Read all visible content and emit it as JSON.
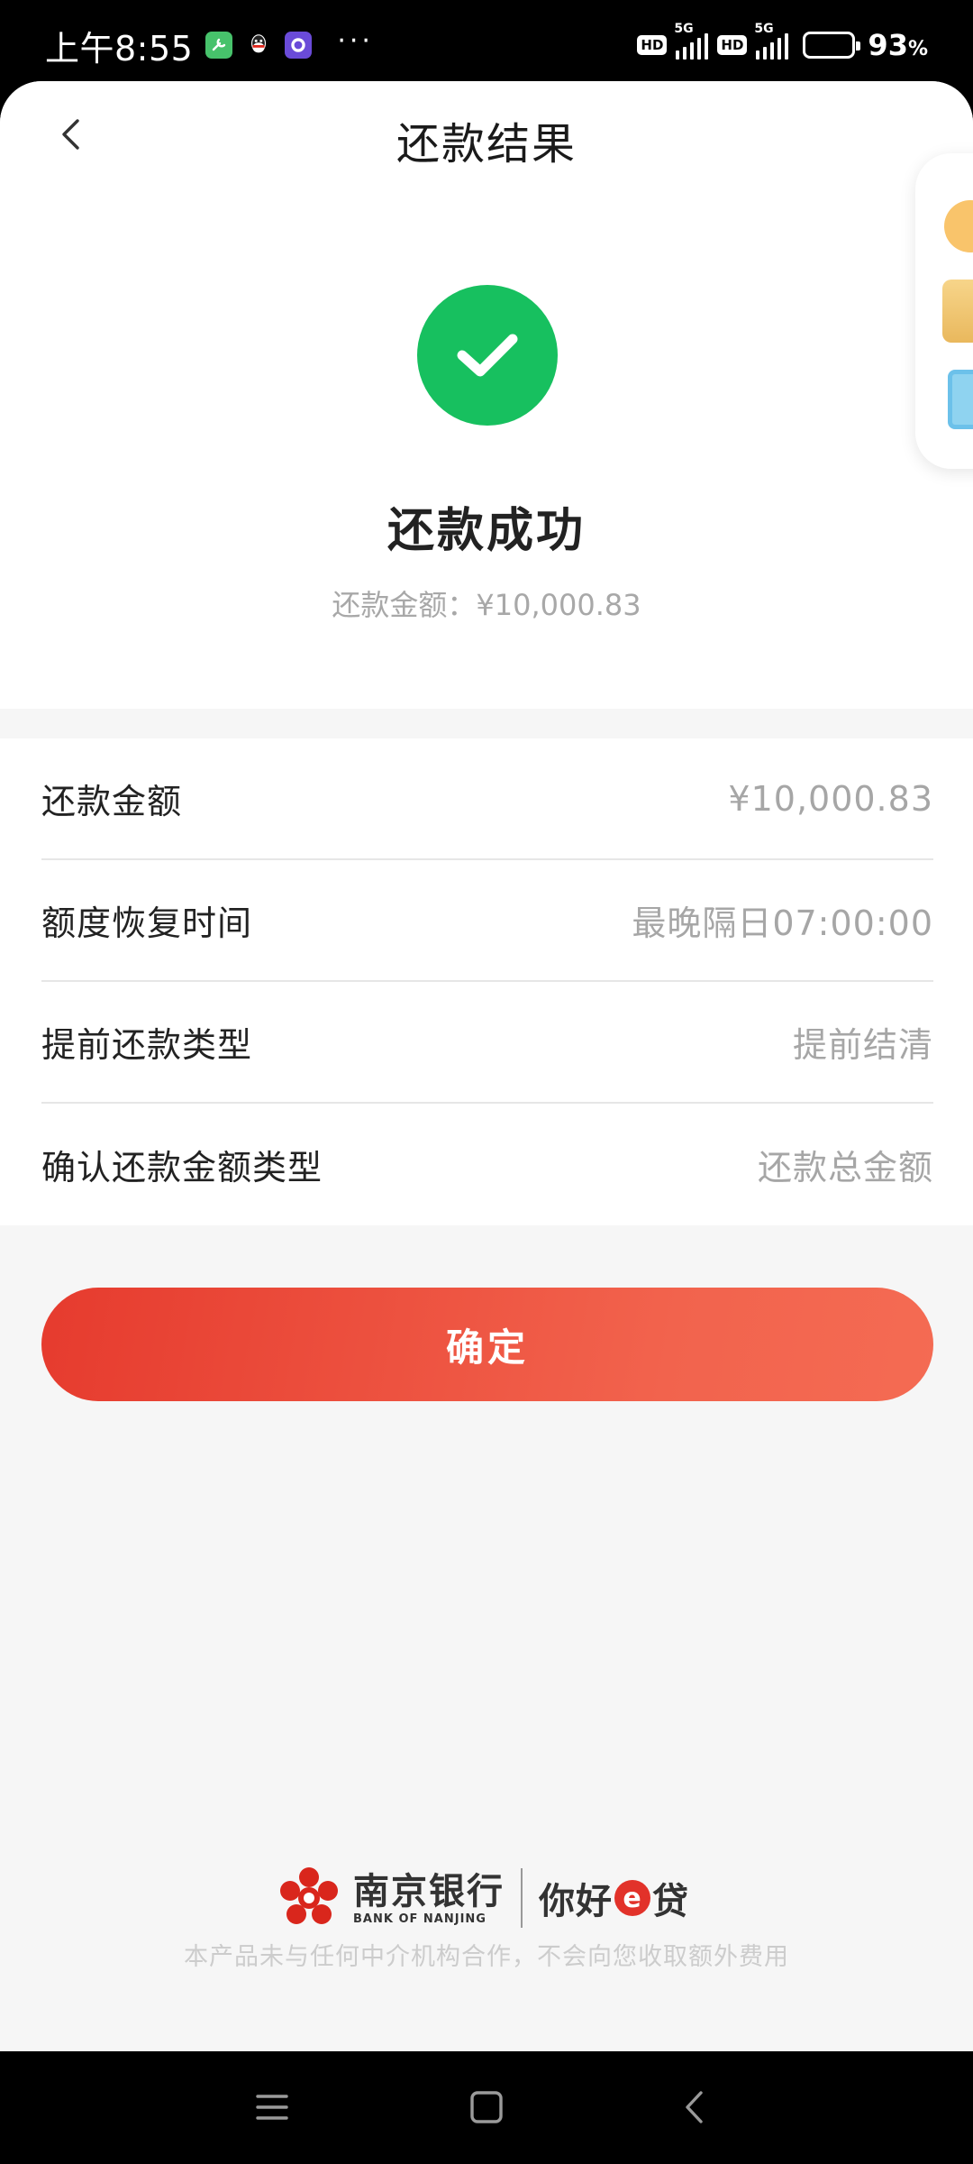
{
  "status_bar": {
    "time": "上午8:55",
    "more": "···",
    "hd1": "HD",
    "net1": "5G",
    "hd2": "HD",
    "net2": "5G",
    "battery_level": 0.93,
    "battery_percent": "93",
    "battery_unit": "%"
  },
  "header": {
    "title": "还款结果",
    "back_icon": "chevron-left-icon"
  },
  "result": {
    "status_icon": "check-circle-icon",
    "status_color": "#17c05f",
    "title": "还款成功",
    "amount_text": "还款金额：¥10,000.83"
  },
  "details": [
    {
      "label": "还款金额",
      "value": "¥10,000.83"
    },
    {
      "label": "额度恢复时间",
      "value": "最晚隔日07:00:00"
    },
    {
      "label": "提前还款类型",
      "value": "提前结清"
    },
    {
      "label": "确认还款金额类型",
      "value": "还款总金额"
    }
  ],
  "confirm_button": {
    "label": "确定",
    "color": "#e63b2e"
  },
  "footer": {
    "bank_name": "南京银行",
    "bank_name_en": "BANK OF NANJING",
    "product_prefix": "你好",
    "product_e": "e",
    "product_suffix": "贷",
    "disclaimer": "本产品未与任何中介机构合作，不会向您收取额外费用"
  },
  "system_nav": {
    "menu_icon": "menu-icon",
    "home_icon": "home-icon",
    "back_icon": "back-icon"
  }
}
